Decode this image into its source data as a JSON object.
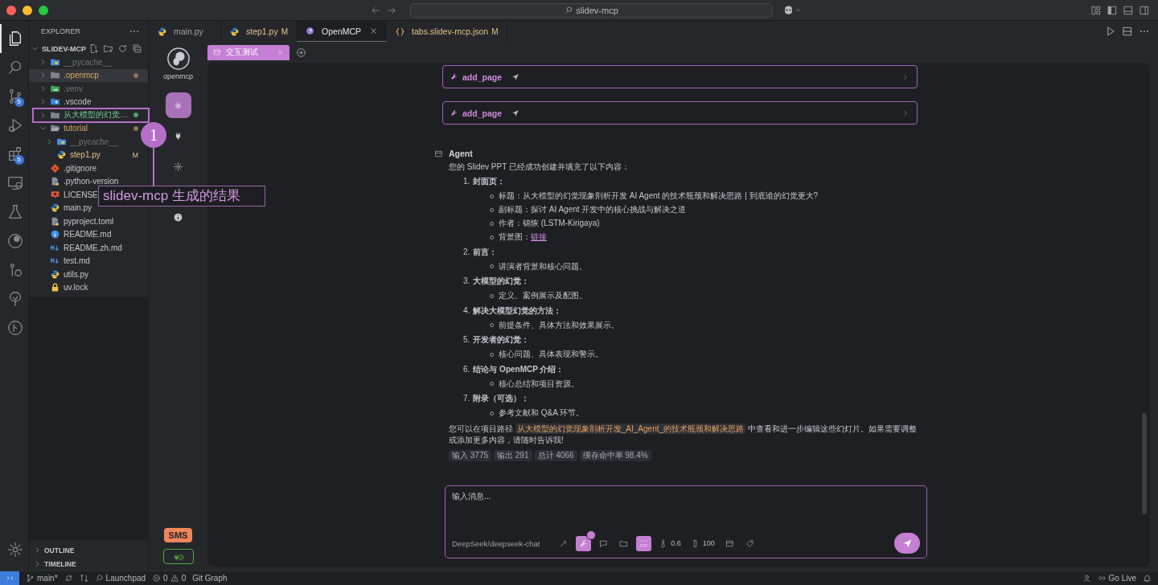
{
  "window": {
    "search": "slidev-mcp"
  },
  "activity_bar": [
    {
      "kind": "files",
      "selected": true
    },
    {
      "kind": "search",
      "selected": false
    },
    {
      "kind": "branch",
      "selected": false,
      "badge": "5"
    },
    {
      "kind": "debug",
      "selected": false
    },
    {
      "kind": "extensions",
      "selected": false,
      "badge": "5"
    },
    {
      "kind": "remote",
      "selected": false
    },
    {
      "kind": "flask",
      "selected": false
    },
    {
      "kind": "globe",
      "selected": false
    },
    {
      "kind": "history",
      "selected": false
    },
    {
      "kind": "tree",
      "selected": false
    },
    {
      "kind": "graph",
      "selected": false
    }
  ],
  "explorer": {
    "title": "EXPLORER",
    "root": "SLIDEV-MCP",
    "tree": [
      {
        "label": "__pycache__",
        "kind": "folder-python",
        "expanded": false,
        "ignored": true,
        "modified": false,
        "untracked": false,
        "dot": false,
        "selected": false
      },
      {
        "label": ".openmcp",
        "kind": "folder",
        "expanded": false,
        "ignored": false,
        "modified": true,
        "untracked": false,
        "dot": true,
        "selected": true
      },
      {
        "label": ".venv",
        "kind": "folder-venv",
        "expanded": false,
        "ignored": true,
        "modified": false,
        "untracked": false,
        "dot": false,
        "selected": false
      },
      {
        "label": ".vscode",
        "kind": "folder-vscode",
        "expanded": false,
        "ignored": false,
        "modified": false,
        "untracked": false,
        "dot": false,
        "selected": false
      },
      {
        "label": "从大模型的幻觉…",
        "kind": "folder",
        "expanded": false,
        "ignored": false,
        "modified": false,
        "untracked": true,
        "dot": true,
        "selected": false
      },
      {
        "label": "tutorial",
        "kind": "folder-open",
        "expanded": true,
        "ignored": false,
        "modified": true,
        "untracked": false,
        "dot": true,
        "selected": false,
        "children": [
          {
            "label": "__pycache__",
            "kind": "folder-python",
            "expanded": false,
            "ignored": true,
            "modified": false,
            "untracked": false,
            "dot": false,
            "selected": false
          },
          {
            "label": "step1.py",
            "kind": "python",
            "ignored": false,
            "modified": true,
            "untracked": false,
            "dot": false,
            "badge": "M",
            "selected": false
          }
        ]
      },
      {
        "label": ".gitignore",
        "kind": "git",
        "ignored": false,
        "modified": false,
        "untracked": false,
        "dot": false,
        "selected": false
      },
      {
        "label": ".python-version",
        "kind": "python-file",
        "ignored": false,
        "modified": false,
        "untracked": false,
        "dot": false,
        "selected": false
      },
      {
        "label": "LICENSE",
        "kind": "license",
        "ignored": false,
        "modified": false,
        "untracked": false,
        "dot": false,
        "selected": false
      },
      {
        "label": "main.py",
        "kind": "python",
        "ignored": false,
        "modified": false,
        "untracked": false,
        "dot": false,
        "selected": false
      },
      {
        "label": "pyproject.toml",
        "kind": "python-file",
        "ignored": false,
        "modified": false,
        "untracked": false,
        "dot": false,
        "selected": false
      },
      {
        "label": "README.md",
        "kind": "info",
        "ignored": false,
        "modified": false,
        "untracked": false,
        "dot": false,
        "selected": false
      },
      {
        "label": "README.zh.md",
        "kind": "markdown",
        "ignored": false,
        "modified": false,
        "untracked": false,
        "dot": false,
        "selected": false
      },
      {
        "label": "test.md",
        "kind": "markdown",
        "ignored": false,
        "modified": false,
        "untracked": false,
        "dot": false,
        "selected": false
      },
      {
        "label": "utils.py",
        "kind": "python",
        "ignored": false,
        "modified": false,
        "untracked": false,
        "dot": false,
        "selected": false
      },
      {
        "label": "uv.lock",
        "kind": "lock",
        "ignored": false,
        "modified": false,
        "untracked": false,
        "dot": false,
        "selected": false
      }
    ],
    "sections": [
      "OUTLINE",
      "TIMELINE"
    ]
  },
  "editor_tabs": [
    {
      "label": "main.py",
      "kind": "python",
      "selected": false
    },
    {
      "label": "step1.py",
      "kind": "python",
      "badge": "M",
      "selected": false
    },
    {
      "label": "OpenMCP",
      "kind": "openmcp",
      "selected": true
    },
    {
      "label": "tabs.slidev-mcp.json",
      "kind": "json",
      "badge": "M",
      "selected": false
    }
  ],
  "openmcp_sidebar": {
    "logo_label": "openmcp",
    "nav": [
      {
        "kind": "bug",
        "selected": true
      },
      {
        "kind": "plug",
        "selected": false
      },
      {
        "kind": "gear",
        "selected": false
      },
      {
        "kind": "info",
        "selected": false
      }
    ],
    "sms": "SMS",
    "connected": true
  },
  "panel_tabs": [
    {
      "label": "交互测试",
      "selected": true
    }
  ],
  "chat": {
    "tool_calls": [
      {
        "name": "add_page"
      },
      {
        "name": "add_page"
      }
    ],
    "message": {
      "sender": "Agent",
      "intro": "您的 Slidev PPT 已经成功创建并填充了以下内容：",
      "sections": [
        {
          "number": "1.",
          "title": "封面页：",
          "bullets": [
            {
              "text": "标题：从大模型的幻觉现象剖析开发 AI Agent 的技术瓶颈和解决思路 | 到底谁的幻觉更大?"
            },
            {
              "text": "副标题：探讨 AI Agent 开发中的核心挑战与解决之道"
            },
            {
              "text": "作者：锦恢 (LSTM-Kirigaya)"
            },
            {
              "text": "背景图：",
              "link": "链接"
            }
          ]
        },
        {
          "number": "2.",
          "title": "前言：",
          "bullets": [
            {
              "text": "讲演者背景和核心问题。"
            }
          ]
        },
        {
          "number": "3.",
          "title": "大模型的幻觉：",
          "bullets": [
            {
              "text": "定义、案例展示及配图。"
            }
          ]
        },
        {
          "number": "4.",
          "title": "解决大模型幻觉的方法：",
          "bullets": [
            {
              "text": "前提条件、具体方法和效果展示。"
            }
          ]
        },
        {
          "number": "5.",
          "title": "开发者的幻觉：",
          "bullets": [
            {
              "text": "核心问题、具体表现和警示。"
            }
          ]
        },
        {
          "number": "6.",
          "title": "结论与 OpenMCP 介绍：",
          "bullets": [
            {
              "text": "核心总结和项目资源。"
            }
          ]
        },
        {
          "number": "7.",
          "title": "附录（可选）：",
          "bullets": [
            {
              "text": "参考文献和 Q&A 环节。"
            }
          ]
        }
      ],
      "closing": {
        "before": "您可以在项目路径 ",
        "code": "从大模型的幻觉现象剖析开发_AI_Agent_的技术瓶颈和解决思路",
        "after": " 中查看和进一步编辑这些幻灯片。如果需要调整或添加更多内容，请随时告诉我!"
      },
      "stats": [
        "输入 3775",
        "输出 291",
        "总计 4066",
        "缓存命中率 98.4%"
      ]
    }
  },
  "input": {
    "placeholder": "输入消息...",
    "model": "DeepSeek/deepseek-chat",
    "tools": [
      {
        "kind": "wand",
        "on": false
      },
      {
        "kind": "wrench",
        "on": true,
        "dot": true
      },
      {
        "kind": "chat",
        "on": false
      },
      {
        "kind": "folder",
        "on": false
      },
      {
        "kind": "grid",
        "on": true
      },
      {
        "kind": "thermometer",
        "on": false,
        "reading": "0.6"
      },
      {
        "kind": "bar",
        "on": false,
        "reading": "100"
      },
      {
        "kind": "card",
        "on": false
      },
      {
        "kind": "tag",
        "on": false
      }
    ]
  },
  "status_bar": {
    "branch": "main*",
    "launchpad": "Launchpad",
    "errors": "0",
    "warnings": "0",
    "git_graph": "Git Graph",
    "go_live": "Go Live"
  },
  "annotation": {
    "number": "1",
    "label": "slidev-mcp 生成的结果"
  }
}
